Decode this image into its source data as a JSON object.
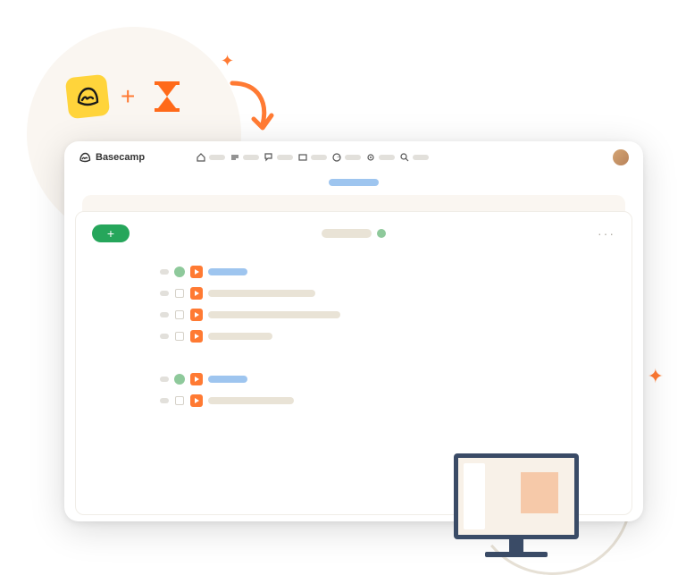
{
  "brand": {
    "name": "Basecamp",
    "icon": "basecamp-logo"
  },
  "logos": {
    "left": "basecamp-badge",
    "plus": "+",
    "right": "hourglass"
  },
  "nav": {
    "items": [
      {
        "icon": "home-icon"
      },
      {
        "icon": "lineup-icon"
      },
      {
        "icon": "pings-icon"
      },
      {
        "icon": "hey-icon"
      },
      {
        "icon": "activity-icon"
      },
      {
        "icon": "stuff-icon"
      },
      {
        "icon": "find-icon"
      }
    ]
  },
  "card": {
    "add_label": "+",
    "more_label": "···"
  },
  "tasks": {
    "group1": [
      {
        "style": "first",
        "blue_w": 44,
        "cream_w": 0
      },
      {
        "style": "child",
        "blue_w": 0,
        "cream_w": 120
      },
      {
        "style": "child",
        "blue_w": 0,
        "cream_w": 148
      },
      {
        "style": "child",
        "blue_w": 0,
        "cream_w": 72
      }
    ],
    "group2": [
      {
        "style": "first",
        "blue_w": 44,
        "cream_w": 0
      },
      {
        "style": "child",
        "blue_w": 0,
        "cream_w": 96
      }
    ]
  },
  "colors": {
    "accent": "#ff7a33",
    "green": "#26a65b",
    "cream": "#e9e3d6",
    "blue": "#9ec5ef"
  }
}
